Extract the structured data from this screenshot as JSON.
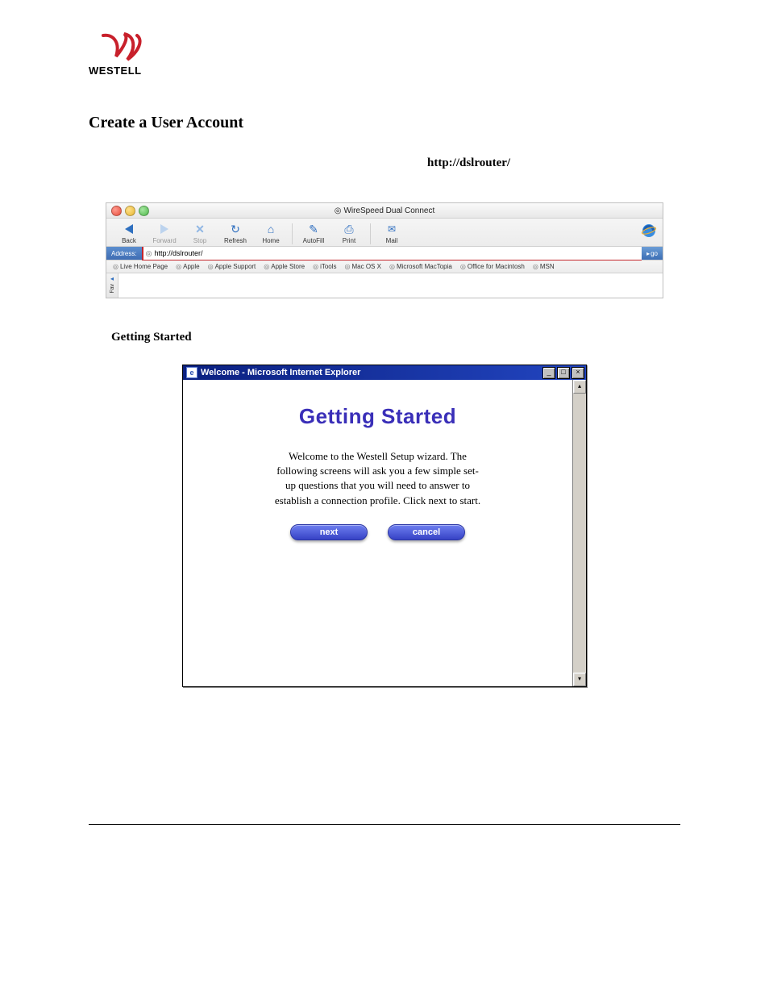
{
  "logo_text": "WESTELL",
  "heading": "Create a User Account",
  "url_text": "http://dslrouter/",
  "mac_browser": {
    "title": "WireSpeed Dual Connect",
    "toolbar": {
      "back": "Back",
      "forward": "Forward",
      "stop": "Stop",
      "refresh": "Refresh",
      "home": "Home",
      "autofill": "AutoFill",
      "print": "Print",
      "mail": "Mail"
    },
    "address_label": "Address:",
    "address_value": "http://dslrouter/",
    "go_label": "go",
    "favorites": [
      "Live Home Page",
      "Apple",
      "Apple Support",
      "Apple Store",
      "iTools",
      "Mac OS X",
      "Microsoft MacTopia",
      "Office for Macintosh",
      "MSN"
    ],
    "side_tab_label": "Fav"
  },
  "subhead": "Getting Started",
  "win_dialog": {
    "title": "Welcome - Microsoft Internet Explorer",
    "heading": "Getting Started",
    "body": "Welcome to the Westell Setup wizard. The following screens will ask you a few simple set-up questions that you will need to answer to establish a connection profile. Click next to start.",
    "next": "next",
    "cancel": "cancel",
    "min": "_",
    "max": "□",
    "close": "×",
    "scroll_up": "▴",
    "scroll_down": "▾"
  }
}
